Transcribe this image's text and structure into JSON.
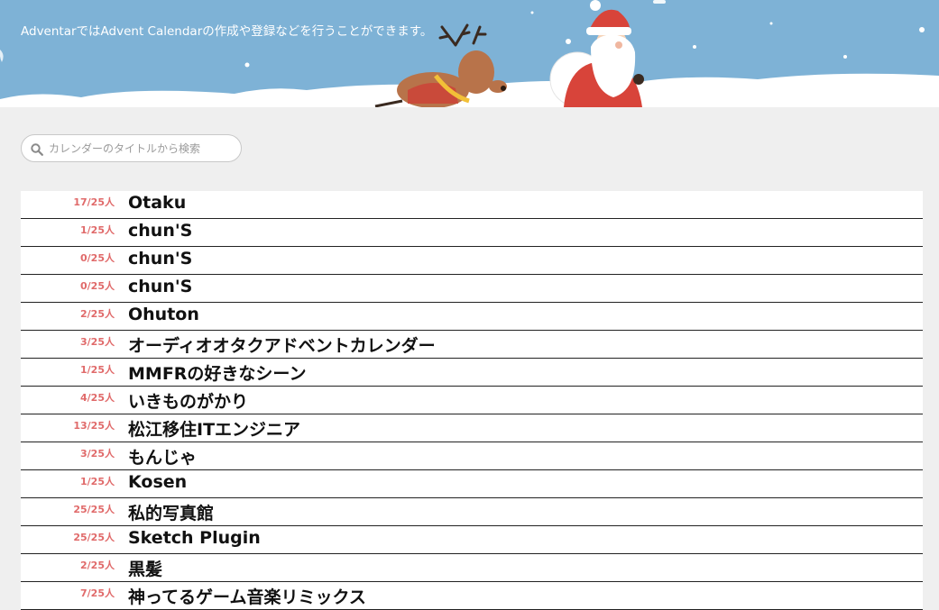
{
  "hero": {
    "description": "AdventarではAdvent Calendarの作成や登録などを行うことができます。"
  },
  "search": {
    "placeholder": "カレンダーのタイトルから検索",
    "icon": "search-icon"
  },
  "calendars": [
    {
      "count": "17/25人",
      "title": "Otaku"
    },
    {
      "count": "1/25人",
      "title": "chun'S"
    },
    {
      "count": "0/25人",
      "title": "chun'S"
    },
    {
      "count": "0/25人",
      "title": "chun'S"
    },
    {
      "count": "2/25人",
      "title": "Ohuton"
    },
    {
      "count": "3/25人",
      "title": "オーディオオタクアドベントカレンダー"
    },
    {
      "count": "1/25人",
      "title": "MMFRの好きなシーン"
    },
    {
      "count": "4/25人",
      "title": "いきものがかり"
    },
    {
      "count": "13/25人",
      "title": "松江移住ITエンジニア"
    },
    {
      "count": "3/25人",
      "title": "もんじゃ"
    },
    {
      "count": "1/25人",
      "title": "Kosen"
    },
    {
      "count": "25/25人",
      "title": "私的写真館"
    },
    {
      "count": "25/25人",
      "title": "Sketch Plugin"
    },
    {
      "count": "2/25人",
      "title": "黒髪"
    },
    {
      "count": "7/25人",
      "title": "神ってるゲーム音楽リミックス"
    }
  ],
  "colors": {
    "hero_background": "#7eb2d6",
    "count_text": "#e06a6a",
    "page_background": "#efefef"
  }
}
